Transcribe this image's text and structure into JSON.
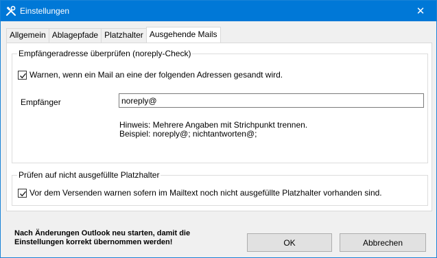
{
  "window": {
    "title": "Einstellungen",
    "close_glyph": "✕",
    "icon": "tools-icon"
  },
  "tabs": [
    {
      "label": "Allgemein",
      "active": false
    },
    {
      "label": "Ablagepfade",
      "active": false
    },
    {
      "label": "Platzhalter",
      "active": false
    },
    {
      "label": "Ausgehende Mails",
      "active": true
    }
  ],
  "noreply_group": {
    "legend": "Empfängeradresse überprüfen (noreply-Check)",
    "warn_checkbox": {
      "label": "Warnen, wenn ein Mail an eine der folgenden Adressen gesandt wird.",
      "checked": true
    },
    "recipient_label": "Empfänger",
    "recipient_value": "noreply@",
    "hint_line1": "Hinweis:  Mehrere Angaben mit Strichpunkt trennen.",
    "hint_line2": "Beispiel: noreply@; nichtantworten@;"
  },
  "placeholder_group": {
    "legend": "Prüfen auf nicht ausgefüllte Platzhalter",
    "warn_checkbox": {
      "label": "Vor dem Versenden warnen sofern im Mailtext noch nicht ausgefüllte Platzhalter vorhanden sind.",
      "checked": true
    }
  },
  "footer": {
    "note": "Nach Änderungen Outlook neu starten, damit die Einstellungen korrekt übernommen werden!",
    "ok_label": "OK",
    "cancel_label": "Abbrechen"
  },
  "colors": {
    "titlebar": "#0078d7",
    "window_bg": "#f0f0f0",
    "panel_bg": "#ffffff"
  }
}
